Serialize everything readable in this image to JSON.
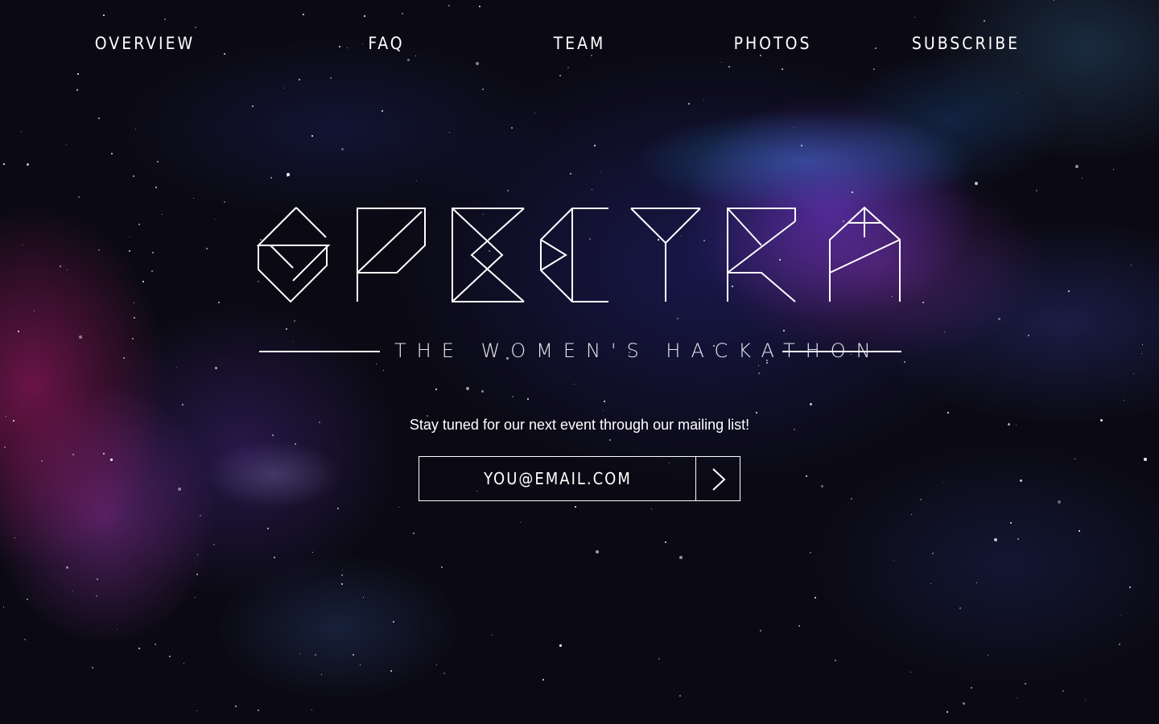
{
  "nav": {
    "items": [
      {
        "label": "OVERVIEW"
      },
      {
        "label": "FAQ"
      },
      {
        "label": "TEAM"
      },
      {
        "label": "PHOTOS"
      },
      {
        "label": "SUBSCRIBE"
      }
    ]
  },
  "hero": {
    "logo_text": "SPECTRA",
    "tagline": "THE WOMEN'S HACKATHON",
    "cta_text": "Stay tuned for our next event through our mailing list!"
  },
  "subscribe": {
    "email_placeholder": "YOU@EMAIL.COM",
    "submit_icon": "chevron-right-icon"
  },
  "colors": {
    "text": "#ffffff",
    "background": "#0b0a14",
    "nebula_purple": "#7a3cdc",
    "nebula_magenta": "#c81e78",
    "nebula_cyan": "#2896dc"
  }
}
